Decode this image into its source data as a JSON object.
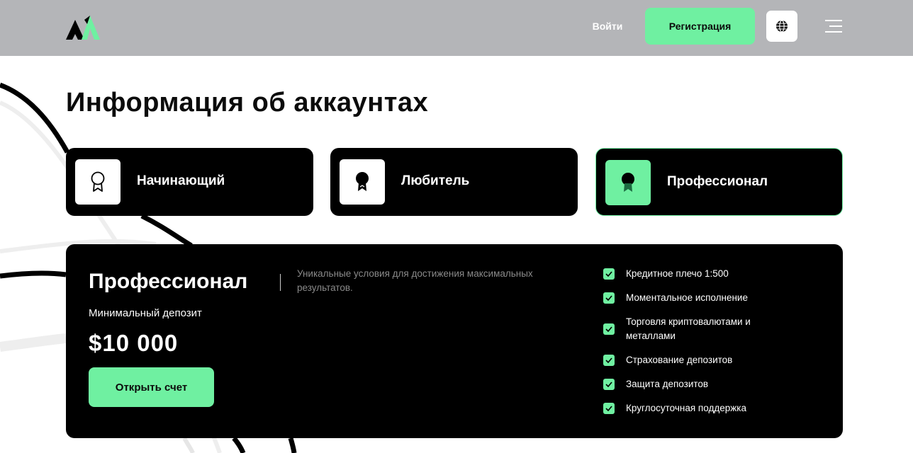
{
  "header": {
    "login_label": "Войти",
    "register_label": "Регистрация",
    "language_icon": "globe-icon",
    "menu_icon": "hamburger-icon"
  },
  "page_title": "Информация об аккаунтах",
  "tiers": [
    {
      "label": "Начинающий",
      "icon": "award-outline-icon",
      "active": false
    },
    {
      "label": "Любитель",
      "icon": "award-filled-icon",
      "active": false
    },
    {
      "label": "Профессионал",
      "icon": "award-filled-icon",
      "active": true
    }
  ],
  "panel": {
    "title": "Профессионал",
    "description": "Уникальные условия для достижения максимальных результатов.",
    "deposit_label": "Минимальный депозит",
    "deposit_value": "$10 000",
    "open_label": "Открыть счет",
    "features": [
      "Кредитное плечо 1:500",
      "Моментальное исполнение",
      "Торговля криптовалютами и металлами",
      "Страхование депозитов",
      "Защита депозитов",
      "Круглосуточная поддержка"
    ]
  },
  "colors": {
    "accent": "#6ff0a1",
    "header_bg": "#b4b5b8",
    "panel_bg": "#000000"
  }
}
